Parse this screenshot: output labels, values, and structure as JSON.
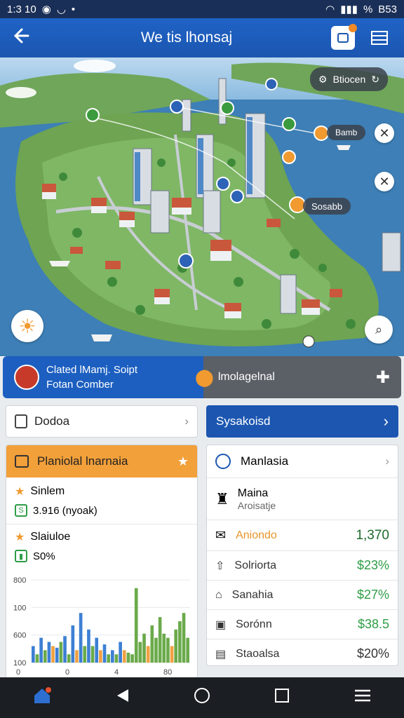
{
  "status": {
    "time": "1:3 10",
    "battery": "B53",
    "signal_text": "%"
  },
  "appbar": {
    "title": "We tis lhonsaj"
  },
  "map": {
    "chips": [
      {
        "text": "Btiocen"
      },
      {
        "text": "Bamb"
      },
      {
        "text": "Sosabb"
      }
    ]
  },
  "banner": {
    "line1": "Clated lMamj. Soipt",
    "line2": "Fotan Comber",
    "right_text": "lmolagelnal"
  },
  "left_button": {
    "label": "Dodoa"
  },
  "right_button": {
    "label": "Sysakoisd"
  },
  "left_card": {
    "title": "Planiolal lnarnaia",
    "items": [
      {
        "label": "Sinlem",
        "value": "3.916 (nyoak)"
      },
      {
        "label": "Slaiuloe",
        "value": "S0%"
      }
    ]
  },
  "chart_data": {
    "type": "bar",
    "ytick_labels": [
      "800",
      "100",
      "600",
      "100"
    ],
    "series": [
      {
        "values": [
          20,
          30,
          25,
          18,
          32,
          45,
          60,
          40,
          30,
          22,
          15,
          25,
          12,
          90,
          35,
          45,
          55,
          30,
          40,
          60
        ]
      },
      {
        "values": [
          10,
          15,
          20,
          25,
          10,
          15,
          20,
          20,
          15,
          10,
          10,
          15,
          10,
          25,
          20,
          30,
          35,
          20,
          50,
          30
        ]
      }
    ],
    "colors": [
      "#3d7fd4",
      "#6aaa4a",
      "#f0a142"
    ],
    "legend_labels": [
      "0",
      "0",
      "4",
      "80"
    ]
  },
  "right_card": {
    "header": "Manlasia",
    "sub_title": "Maina",
    "sub_label": "Aroisatje",
    "highlight_label": "Aniondo",
    "highlight_value": "1,370",
    "rows": [
      {
        "label": "Solriorta",
        "value": "$23%"
      },
      {
        "label": "Sanahia",
        "value": "$27%"
      },
      {
        "label": "Sorónn",
        "value": "$38.5"
      },
      {
        "label": "Staoalsa",
        "value": "$20%"
      }
    ]
  }
}
